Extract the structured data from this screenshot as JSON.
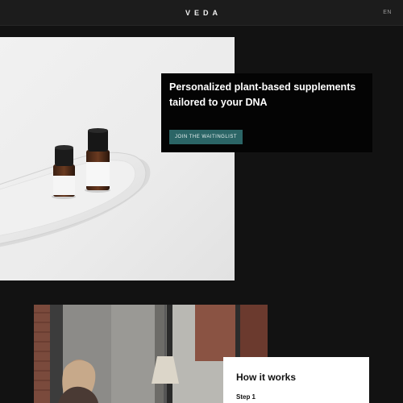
{
  "header": {
    "logo": "VEDA",
    "language": "EN"
  },
  "hero": {
    "title": "Personalized plant-based supplements tailored to your DNA",
    "cta_label": "JOIN THE WAITINGLIST",
    "cta_color": "#2b6566"
  },
  "how_it_works": {
    "title": "How it works",
    "step_label": "Step 1"
  }
}
